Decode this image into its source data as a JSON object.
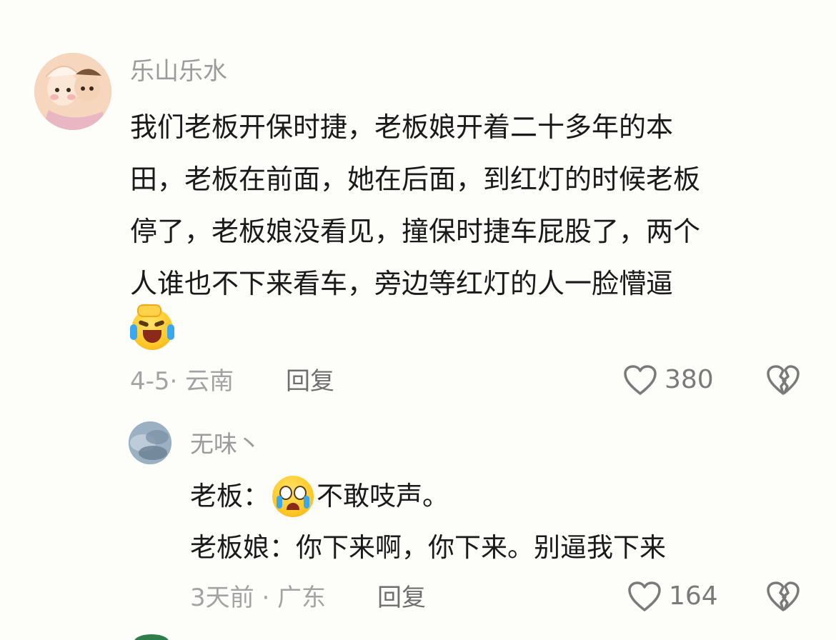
{
  "comment": {
    "username": "乐山乐水",
    "text_lines": [
      "我们老板开保时捷，老板娘开着二十多年的本",
      "田，老板在前面，她在后面，到红灯的时候老板",
      "停了，老板娘没看见，撞保时捷车屁股了，两个",
      "人谁也不下来看车，旁边等红灯的人一脸懵逼"
    ],
    "emoji": "laughing-crying-emoji",
    "meta": "4-5· 云南",
    "reply_label": "回复",
    "like_count": "380"
  },
  "reply": {
    "username": "无味丶",
    "line1_prefix": "老板：",
    "line1_emoji": "pleading-tears-emoji",
    "line1_suffix": "不敢吱声。",
    "line2": "老板娘：你下来啊，你下来。别逼我下来",
    "meta": "3天前 · 广东",
    "reply_label": "回复",
    "like_count": "164"
  },
  "icons": {
    "like": "heart-outline-icon",
    "dislike": "broken-heart-icon"
  },
  "colors": {
    "background": "#fdfdfa",
    "text_primary": "#1a1a1a",
    "text_secondary": "#9b9b9b"
  }
}
